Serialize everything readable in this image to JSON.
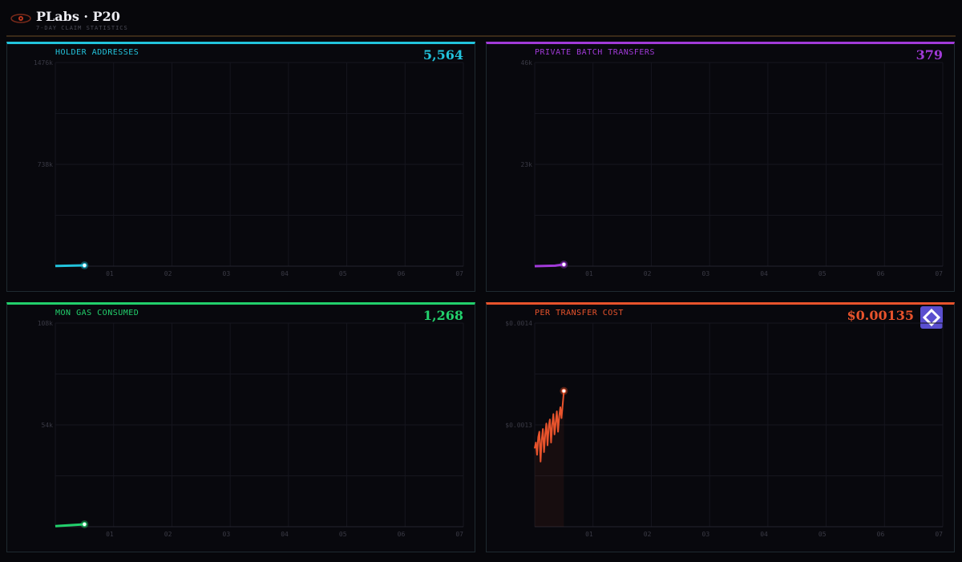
{
  "header": {
    "title": "PLabs · P20",
    "subtitle": "7-DAY CLAIM STATISTICS"
  },
  "panels": [
    {
      "id": "holder",
      "title": "HOLDER ADDRESSES",
      "value": "5,564",
      "accent": "#22c3dc"
    },
    {
      "id": "batch",
      "title": "PRIVATE BATCH TRANSFERS",
      "value": "379",
      "accent": "#a13ad8"
    },
    {
      "id": "gas",
      "title": "MON GAS CONSUMED",
      "value": "1,268",
      "accent": "#22d06c"
    },
    {
      "id": "cost",
      "title": "PER TRANSFER COST",
      "value": "$0.00135",
      "accent": "#e8532c",
      "badge_icon": "diamond-logo-icon"
    }
  ],
  "chart_data": [
    {
      "type": "line",
      "title": "HOLDER ADDRESSES",
      "x_ticks": [
        "01",
        "02",
        "03",
        "04",
        "05",
        "06",
        "07"
      ],
      "y_ticks": [
        "1476k",
        "738k"
      ],
      "ylim": [
        0,
        1476000
      ],
      "xlim": [
        0,
        7
      ],
      "grid": true,
      "series": [
        {
          "x": [
            0,
            0.5
          ],
          "y": [
            2000,
            5564
          ]
        }
      ]
    },
    {
      "type": "line",
      "title": "PRIVATE BATCH TRANSFERS",
      "x_ticks": [
        "01",
        "02",
        "03",
        "04",
        "05",
        "06",
        "07"
      ],
      "y_ticks": [
        "46k",
        "23k"
      ],
      "ylim": [
        0,
        46000
      ],
      "xlim": [
        0,
        7
      ],
      "grid": true,
      "series": [
        {
          "x": [
            0,
            0.35,
            0.5
          ],
          "y": [
            0,
            100,
            379
          ]
        }
      ]
    },
    {
      "type": "line",
      "title": "MON GAS CONSUMED",
      "x_ticks": [
        "01",
        "02",
        "03",
        "04",
        "05",
        "06",
        "07"
      ],
      "y_ticks": [
        "108k",
        "54k"
      ],
      "ylim": [
        0,
        108000
      ],
      "xlim": [
        0,
        7
      ],
      "grid": true,
      "series": [
        {
          "x": [
            0,
            0.5
          ],
          "y": [
            300,
            1268
          ]
        }
      ]
    },
    {
      "type": "area",
      "title": "PER TRANSFER COST",
      "x_ticks": [
        "01",
        "02",
        "03",
        "04",
        "05",
        "06",
        "07"
      ],
      "y_ticks": [
        "$0.0014",
        "$0.0013"
      ],
      "ylim": [
        0.00125,
        0.0014
      ],
      "xlim": [
        0,
        7
      ],
      "grid": true,
      "series": [
        {
          "x": [
            0,
            0.02,
            0.04,
            0.06,
            0.08,
            0.1,
            0.12,
            0.14,
            0.16,
            0.18,
            0.2,
            0.22,
            0.24,
            0.26,
            0.28,
            0.3,
            0.32,
            0.34,
            0.36,
            0.38,
            0.4,
            0.42,
            0.44,
            0.46,
            0.48,
            0.5
          ],
          "y": [
            0.001308,
            0.001312,
            0.001303,
            0.001316,
            0.00132,
            0.001298,
            0.001314,
            0.001322,
            0.001305,
            0.001318,
            0.001326,
            0.00131,
            0.001324,
            0.001329,
            0.001312,
            0.001325,
            0.001333,
            0.001318,
            0.001327,
            0.001335,
            0.00132,
            0.001331,
            0.001338,
            0.00133,
            0.00134,
            0.00135
          ]
        }
      ]
    }
  ]
}
